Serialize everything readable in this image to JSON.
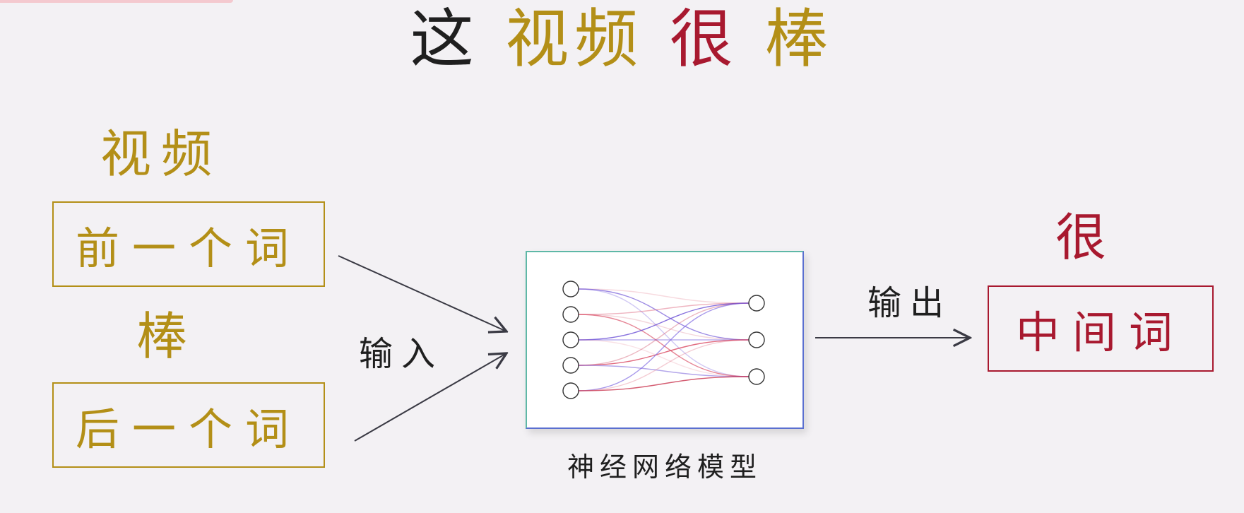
{
  "title": {
    "parts": [
      {
        "text": "这",
        "color": "#1f1f1f"
      },
      {
        "text": "视频",
        "color": "#b38f17"
      },
      {
        "text": "很",
        "color": "#a8192f"
      },
      {
        "text": "棒",
        "color": "#b38f17"
      }
    ]
  },
  "left": {
    "prev_word": "视频",
    "prev_box": "前一个词",
    "next_word": "棒",
    "next_box": "后一个词"
  },
  "input_label": "输入",
  "network": {
    "caption": "神经网络模型",
    "input_nodes": 5,
    "output_nodes": 3
  },
  "output_label": "输出",
  "right": {
    "word": "很",
    "box": "中间词"
  },
  "colors": {
    "gold": "#b38f17",
    "crimson": "#a8192f",
    "text": "#1f1f1f",
    "background": "#f3f1f4"
  }
}
